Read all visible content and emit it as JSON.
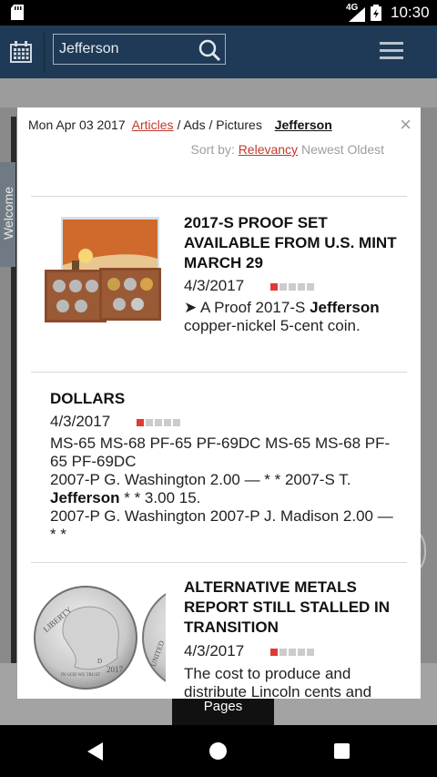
{
  "status_bar": {
    "network": "4G",
    "time": "10:30"
  },
  "header": {
    "search_value": "Jefferson",
    "icons": [
      "calendar-icon",
      "search-icon",
      "menu-icon"
    ]
  },
  "background": {
    "welcome_tab": "Welcome",
    "pages_tab": "Pages"
  },
  "modal": {
    "date": "Mon Apr 03 2017",
    "tabs": {
      "articles": "Articles",
      "sep1": "/",
      "ads": "Ads",
      "sep2": "/",
      "pictures": "Pictures"
    },
    "search_term": "Jefferson",
    "close_label": "×",
    "sort": {
      "label": "Sort by:",
      "relevancy": "Relevancy",
      "newest": "Newest",
      "oldest": "Oldest"
    },
    "colors": {
      "accent": "#c0392b",
      "bar_on": "#e03a36",
      "bar_off": "#cccccc",
      "header_bg": "#1e3a56"
    },
    "results": [
      {
        "title": "2017-S PROOF SET AVAILABLE FROM U.S. MINT MARCH 29",
        "date": "4/3/2017",
        "relevance_bars": 1,
        "relevance_total": 5,
        "snippet_prefix": "➤ A Proof 2017-S ",
        "snippet_bold": "Jefferson",
        "snippet_suffix": " copper-nickel 5-cent coin."
      },
      {
        "title": "DOLLARS",
        "date": "4/3/2017",
        "relevance_bars": 1,
        "relevance_total": 5,
        "line1": "MS-65 MS-68 PF-65 PF-69DC MS-65 MS-68 PF-65 PF-69DC",
        "line2": "2007-P G. Washington 2.00 — * * 2007-S T.",
        "line3_bold": "Jefferson",
        "line3_rest": " * * 3.00 15.",
        "line4": "2007-P G. Washington 2007-P J. Madison 2.00 — * *"
      },
      {
        "title": "ALTERNATIVE METALS REPORT STILL STALLED IN TRANSITION",
        "date": "4/3/2017",
        "relevance_bars": 1,
        "relevance_total": 5,
        "snippet": "The cost to produce and distribute Lincoln cents and"
      }
    ],
    "coin_text": {
      "liberty": "LIBERTY",
      "in_god": "IN GOD WE TRUST",
      "year": "2017",
      "mint": "D",
      "united": "UNITED"
    }
  }
}
